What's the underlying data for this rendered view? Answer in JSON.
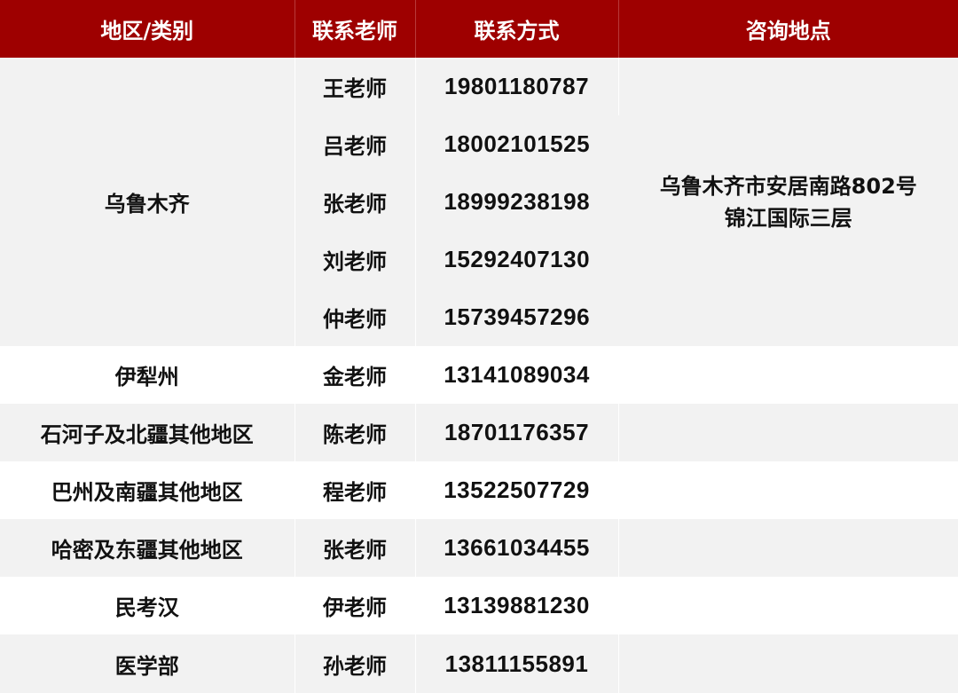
{
  "table": {
    "headers": [
      "地区/类别",
      "联系老师",
      "联系方式",
      "咨询地点"
    ],
    "urumqi_group": {
      "region": "乌鲁木齐",
      "address_line1": "乌鲁木齐市安居南路802号",
      "address_line2": "锦江国际三层",
      "rows": [
        {
          "teacher": "王老师",
          "phone": "19801180787"
        },
        {
          "teacher": "吕老师",
          "phone": "18002101525"
        },
        {
          "teacher": "张老师",
          "phone": "18999238198"
        },
        {
          "teacher": "刘老师",
          "phone": "15292407130"
        },
        {
          "teacher": "仲老师",
          "phone": "15739457296"
        }
      ]
    },
    "rows": [
      {
        "region": "伊犁州",
        "teacher": "金老师",
        "phone": "13141089034",
        "address": ""
      },
      {
        "region": "石河子及北疆其他地区",
        "teacher": "陈老师",
        "phone": "18701176357",
        "address": ""
      },
      {
        "region": "巴州及南疆其他地区",
        "teacher": "程老师",
        "phone": "13522507729",
        "address": ""
      },
      {
        "region": "哈密及东疆其他地区",
        "teacher": "张老师",
        "phone": "13661034455",
        "address": ""
      },
      {
        "region": "民考汉",
        "teacher": "伊老师",
        "phone": "13139881230",
        "address": ""
      },
      {
        "region": "医学部",
        "teacher": "孙老师",
        "phone": "13811155891",
        "address": ""
      }
    ]
  },
  "colors": {
    "header_bg": "#9e0000",
    "header_text": "#ffffff",
    "shaded_row": "#f2f2f2",
    "plain_row": "#ffffff"
  }
}
